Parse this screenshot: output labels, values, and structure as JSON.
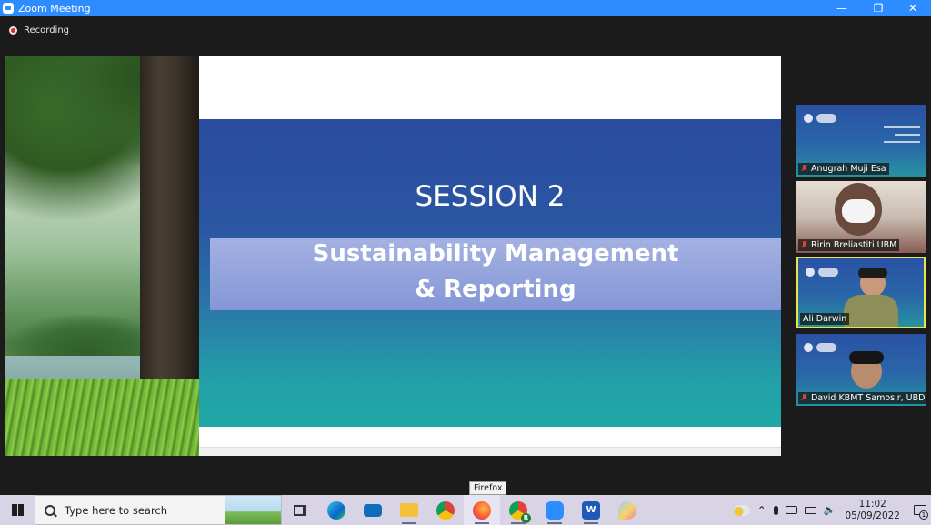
{
  "window": {
    "title": "Zoom Meeting",
    "minimize": "—",
    "restore": "❐",
    "close": "✕"
  },
  "recording": {
    "label": "Recording"
  },
  "slide": {
    "heading": "SESSION 2",
    "subtitle_line1": "Sustainability Management",
    "subtitle_line2": "&  Reporting"
  },
  "participants": [
    {
      "name": "Anugrah Muji Esa",
      "muted": true,
      "video": false
    },
    {
      "name": "Ririn Breliastiti UBM",
      "muted": true,
      "video": true
    },
    {
      "name": "Ali Darwin",
      "muted": false,
      "video": true,
      "active_speaker": true
    },
    {
      "name": "David KBMT Samosir, UBD",
      "muted": true,
      "video": true
    }
  ],
  "tooltip": {
    "text": "Firefox"
  },
  "taskbar": {
    "search_placeholder": "Type here to search",
    "apps": [
      {
        "name": "Task View",
        "icon": "task-view-icon"
      },
      {
        "name": "Microsoft Edge",
        "icon": "edge-icon"
      },
      {
        "name": "Mail",
        "icon": "mail-icon"
      },
      {
        "name": "File Explorer",
        "icon": "folder-icon"
      },
      {
        "name": "Google Chrome",
        "icon": "chrome-icon"
      },
      {
        "name": "Firefox",
        "icon": "firefox-icon"
      },
      {
        "name": "Google Chrome profile",
        "icon": "chrome-profile-icon"
      },
      {
        "name": "Zoom",
        "icon": "zoom-icon"
      },
      {
        "name": "Microsoft Word",
        "icon": "word-icon"
      },
      {
        "name": "Paint",
        "icon": "paint-icon"
      }
    ],
    "word_letter": "W",
    "chrome_profile_letter": "R",
    "time": "11:02",
    "date": "05/09/2022",
    "notification_count": "1"
  },
  "colors": {
    "zoom_blue": "#2d8cff",
    "active_speaker": "#e7e54a",
    "slide_band_top": "#2a4ca0",
    "slide_band_bottom": "#1fa8a6"
  }
}
